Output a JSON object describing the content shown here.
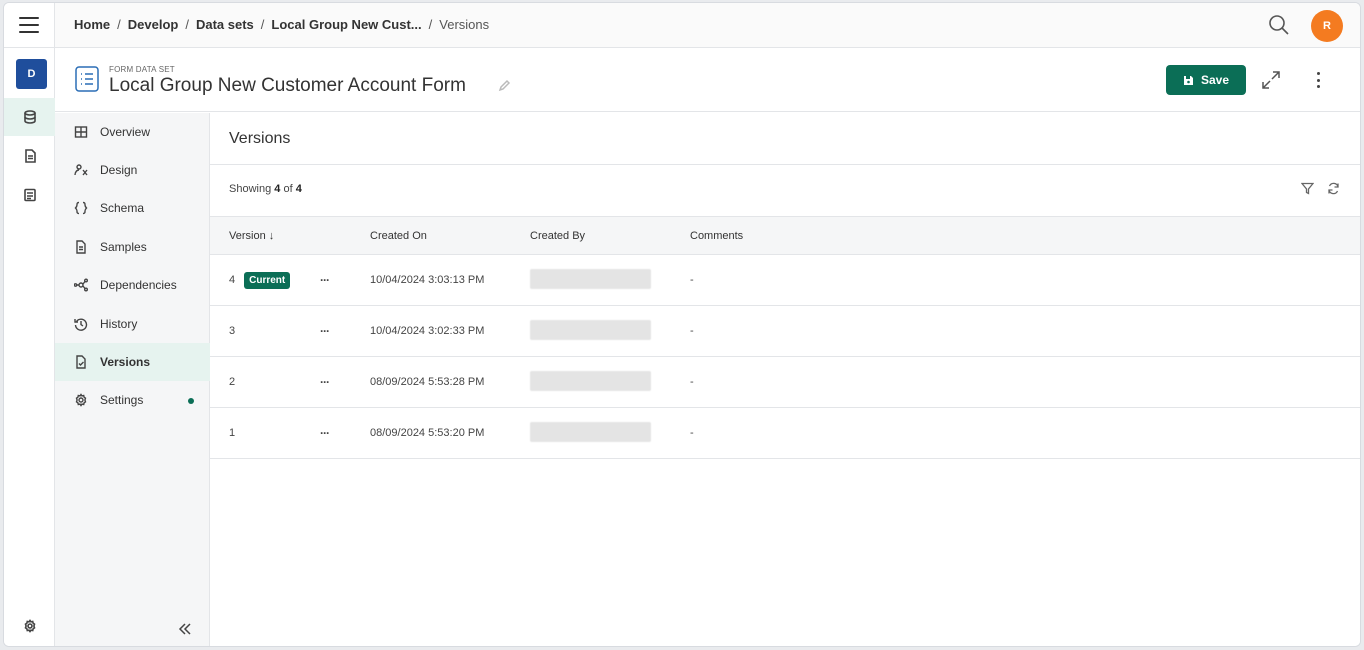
{
  "rail": {
    "workspace_initial": "D"
  },
  "breadcrumb": {
    "items": [
      "Home",
      "Develop",
      "Data sets",
      "Local Group New Cust..."
    ],
    "current": "Versions"
  },
  "user": {
    "initial": "R",
    "color": "#f47b20"
  },
  "header": {
    "kind": "FORM DATA SET",
    "title": "Local Group New Customer Account Form",
    "save_label": "Save"
  },
  "sidenav": {
    "items": [
      {
        "label": "Overview",
        "icon": "grid-icon"
      },
      {
        "label": "Design",
        "icon": "design-icon"
      },
      {
        "label": "Schema",
        "icon": "braces-icon"
      },
      {
        "label": "Samples",
        "icon": "document-icon"
      },
      {
        "label": "Dependencies",
        "icon": "graph-icon"
      },
      {
        "label": "History",
        "icon": "history-icon"
      },
      {
        "label": "Versions",
        "icon": "document-check-icon"
      },
      {
        "label": "Settings",
        "icon": "gear-icon"
      }
    ]
  },
  "main": {
    "section_title": "Versions",
    "showing_prefix": "Showing",
    "showing_count": "4",
    "showing_of": "of",
    "showing_total": "4",
    "columns": [
      "Version ↓",
      "Created On",
      "Created By",
      "Comments"
    ],
    "rows": [
      {
        "version": "4",
        "current": "Current",
        "created_on": "10/04/2024 3:03:13 PM",
        "comments": "-"
      },
      {
        "version": "3",
        "current": "",
        "created_on": "10/04/2024 3:02:33 PM",
        "comments": "-"
      },
      {
        "version": "2",
        "current": "",
        "created_on": "08/09/2024 5:53:28 PM",
        "comments": "-"
      },
      {
        "version": "1",
        "current": "",
        "created_on": "08/09/2024 5:53:20 PM",
        "comments": "-"
      }
    ],
    "row_menu": "···"
  },
  "colors": {
    "accent": "#0b6e56",
    "workspace": "#1f4e9c",
    "avatar": "#f47b20"
  }
}
